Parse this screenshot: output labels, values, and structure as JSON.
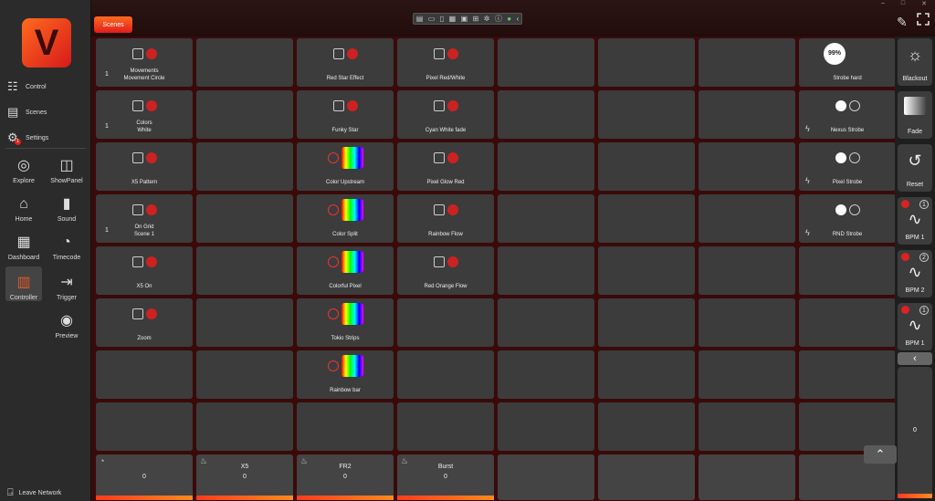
{
  "app": {
    "logo_letter": "V"
  },
  "sidebar": {
    "top_items": [
      {
        "label": "Control",
        "icon": "sliders-icon"
      },
      {
        "label": "Scenes",
        "icon": "clapper-icon"
      },
      {
        "label": "Settings",
        "icon": "gear-icon",
        "badge": "1"
      }
    ],
    "tiles": [
      {
        "label": "Explore",
        "icon": "compass-icon"
      },
      {
        "label": "ShowPanel",
        "icon": "panel-icon"
      },
      {
        "label": "Home",
        "icon": "home-icon"
      },
      {
        "label": "Sound",
        "icon": "bars-icon"
      },
      {
        "label": "Dashboard",
        "icon": "dashboard-icon"
      },
      {
        "label": "Timecode",
        "icon": "stopwatch-icon"
      },
      {
        "label": "Controller",
        "icon": "controller-icon",
        "active": true
      },
      {
        "label": "Trigger",
        "icon": "trigger-icon"
      },
      {
        "label": "Preview",
        "icon": "eye-icon"
      }
    ],
    "leave": "Leave Network"
  },
  "header": {
    "tab": "Scenes"
  },
  "grid": {
    "cells": [
      {
        "row": 0,
        "col": 0,
        "label": "Movements\nMovement Circle",
        "num": "1"
      },
      {
        "row": 0,
        "col": 2,
        "label": "Red Star Effect"
      },
      {
        "row": 0,
        "col": 3,
        "label": "Pixel Red/White"
      },
      {
        "row": 0,
        "col": 7,
        "label": "Strobe hard",
        "badge": "99%"
      },
      {
        "row": 1,
        "col": 0,
        "label": "Colors\nWhite",
        "num": "1"
      },
      {
        "row": 1,
        "col": 2,
        "label": "Funky Star"
      },
      {
        "row": 1,
        "col": 3,
        "label": "Cyan White fade"
      },
      {
        "row": 1,
        "col": 7,
        "label": "Nexus Strobe",
        "bolt": true
      },
      {
        "row": 2,
        "col": 0,
        "label": "X5 Pattern"
      },
      {
        "row": 2,
        "col": 2,
        "label": "Color Upstream"
      },
      {
        "row": 2,
        "col": 3,
        "label": "Pixel Glow Red"
      },
      {
        "row": 2,
        "col": 7,
        "label": "Pixel Strobe",
        "bolt": true
      },
      {
        "row": 3,
        "col": 0,
        "label": "On Grid\nScene 1",
        "num": "1"
      },
      {
        "row": 3,
        "col": 2,
        "label": "Color Split"
      },
      {
        "row": 3,
        "col": 3,
        "label": "Rainbow Flow"
      },
      {
        "row": 3,
        "col": 7,
        "label": "RND Strobe",
        "bolt": true
      },
      {
        "row": 4,
        "col": 0,
        "label": "X5  On"
      },
      {
        "row": 4,
        "col": 2,
        "label": "Colorful Pixel"
      },
      {
        "row": 4,
        "col": 3,
        "label": "Red Orange Flow"
      },
      {
        "row": 5,
        "col": 0,
        "label": "Zoom"
      },
      {
        "row": 5,
        "col": 2,
        "label": "Tokio Strips"
      },
      {
        "row": 6,
        "col": 2,
        "label": "Rainbow bar"
      }
    ]
  },
  "faders": [
    {
      "name": "",
      "value": "0",
      "icon": "speed-icon"
    },
    {
      "name": "X5",
      "value": "0",
      "icon": "bulb-icon"
    },
    {
      "name": "FR2",
      "value": "0",
      "icon": "bulb-icon"
    },
    {
      "name": "Burst",
      "value": "0",
      "icon": "bulb-icon"
    }
  ],
  "right": {
    "blackout": "Blackout",
    "fade": "Fade",
    "reset": "Reset",
    "bpm": [
      {
        "label": "BPM 1",
        "n": "1"
      },
      {
        "label": "BPM 2",
        "n": "2"
      },
      {
        "label": "BPM 1",
        "n": "1"
      }
    ],
    "master_value": "0"
  }
}
